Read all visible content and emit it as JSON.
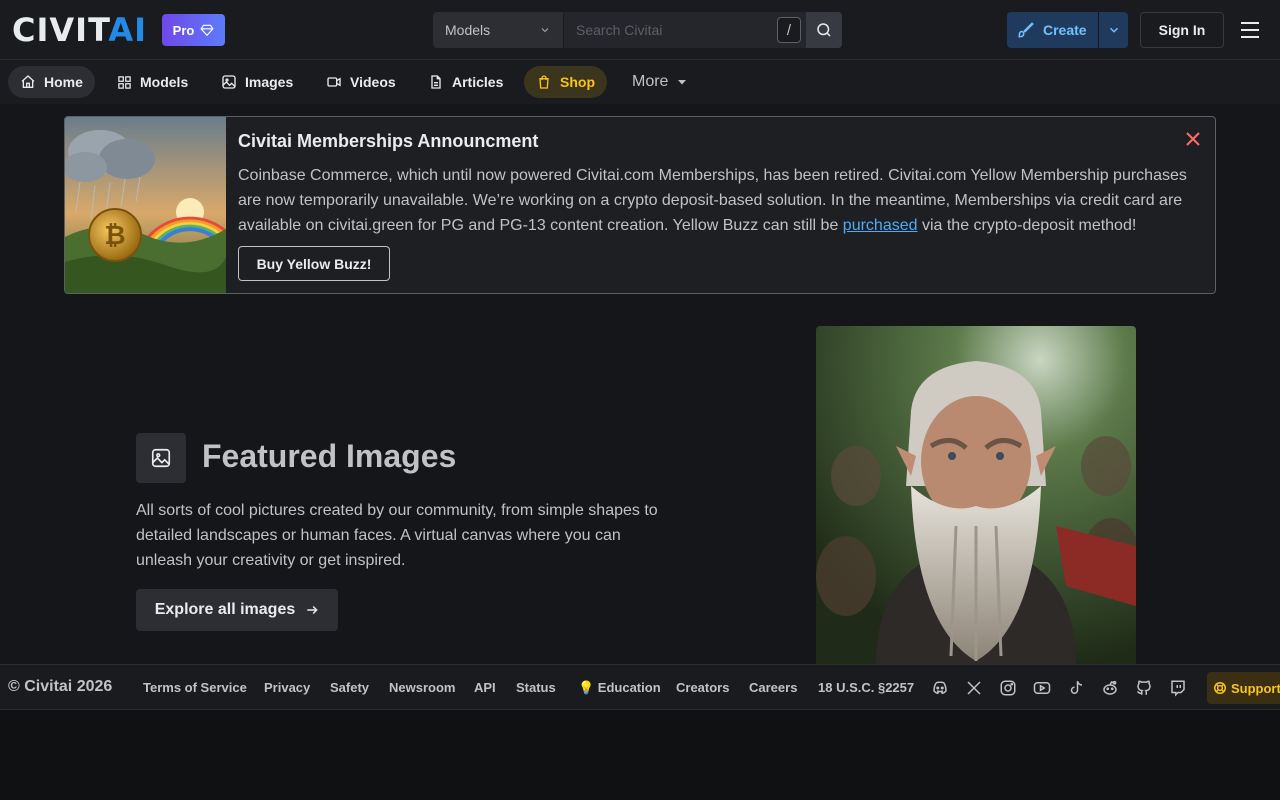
{
  "header": {
    "logo_main": "CIVIT",
    "logo_accent": "AI",
    "pro_label": "Pro",
    "search": {
      "type_selected": "Models",
      "placeholder": "Search Civitai",
      "shortcut": "/"
    },
    "create_label": "Create",
    "signin_label": "Sign In"
  },
  "nav": {
    "items": [
      {
        "label": "Home",
        "icon": "home-icon"
      },
      {
        "label": "Models",
        "icon": "grid-icon"
      },
      {
        "label": "Images",
        "icon": "photo-icon"
      },
      {
        "label": "Videos",
        "icon": "video-icon"
      },
      {
        "label": "Articles",
        "icon": "file-text-icon"
      },
      {
        "label": "Shop",
        "icon": "shopping-bag-icon"
      },
      {
        "label": "More",
        "icon": "caret-down-icon"
      }
    ]
  },
  "announcement": {
    "title": "Civitai Memberships Announcment",
    "body_before_link": "Coinbase Commerce, which until now powered Civitai.com Memberships, has been retired. Civitai.com Yellow Membership purchases are now temporarily unavailable. We’re working on a crypto deposit-based solution. In the meantime, Memberships via credit card are available on civitai.green for PG and PG-13 content creation. Yellow Buzz can still be ",
    "link_text": "purchased",
    "body_after_link": " via the crypto-deposit method!",
    "button_label": "Buy Yellow Buzz!"
  },
  "featured": {
    "title": "Featured Images",
    "description": "All sorts of cool pictures created by our community, from simple shapes to detailed landscapes or human faces. A virtual canvas where you can unleash your creativity or get inspired.",
    "button_label": "Explore all images"
  },
  "footer": {
    "copyright": "© Civitai 2026",
    "links": [
      "Terms of Service",
      "Privacy",
      "Safety",
      "Newsroom",
      "API",
      "Status",
      "💡 Education",
      "Creators",
      "Careers",
      "18 U.S.C. §2257"
    ],
    "socials": [
      "discord-icon",
      "x-icon",
      "instagram-icon",
      "youtube-icon",
      "tiktok-icon",
      "reddit-icon",
      "github-icon",
      "twitch-icon"
    ],
    "support_label": "Support"
  },
  "colors": {
    "accent": "#228be6",
    "shop": "#fcc419",
    "background": "#15161a"
  }
}
